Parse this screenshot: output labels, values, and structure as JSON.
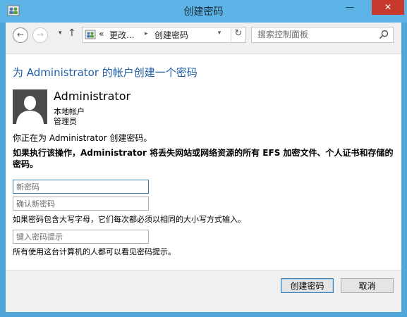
{
  "window": {
    "title": "创建密码",
    "minimize_glyph": "—",
    "maximize_glyph": "☐",
    "close_glyph": "✕"
  },
  "navbar": {
    "back_glyph": "←",
    "forward_glyph": "→",
    "history_glyph": "▾",
    "up_glyph": "↑",
    "breadcrumb_overflow": "«",
    "breadcrumbs": [
      "更改...",
      "创建密码"
    ],
    "crumb_separator": "▸",
    "dropdown_glyph": "▾",
    "refresh_glyph": "↻",
    "search_placeholder": "搜索控制面板"
  },
  "content": {
    "heading": "为 Administrator 的帐户创建一个密码",
    "user": {
      "name": "Administrator",
      "type": "本地帐户",
      "role": "管理员"
    },
    "info_text": "你正在为 Administrator 创建密码。",
    "warning_text": "如果执行该操作，Administrator 将丢失网站或网络资源的所有 EFS 加密文件、个人证书和存储的密码。",
    "new_password_placeholder": "新密码",
    "confirm_password_placeholder": "确认新密码",
    "case_note": "如果密码包含大写字母，它们每次都必须以相同的大小写方式输入。",
    "hint_placeholder": "键入密码提示",
    "hint_note": "所有使用这台计算机的人都可以看见密码提示。"
  },
  "footer": {
    "create_label": "创建密码",
    "cancel_label": "取消"
  },
  "icons": {
    "app": "users-control-panel-icon",
    "avatar": "user-silhouette-icon",
    "search": "search-icon"
  },
  "colors": {
    "titlebar": "#5cb3e6",
    "heading": "#1f5fa8",
    "close_button": "#c7392d"
  }
}
